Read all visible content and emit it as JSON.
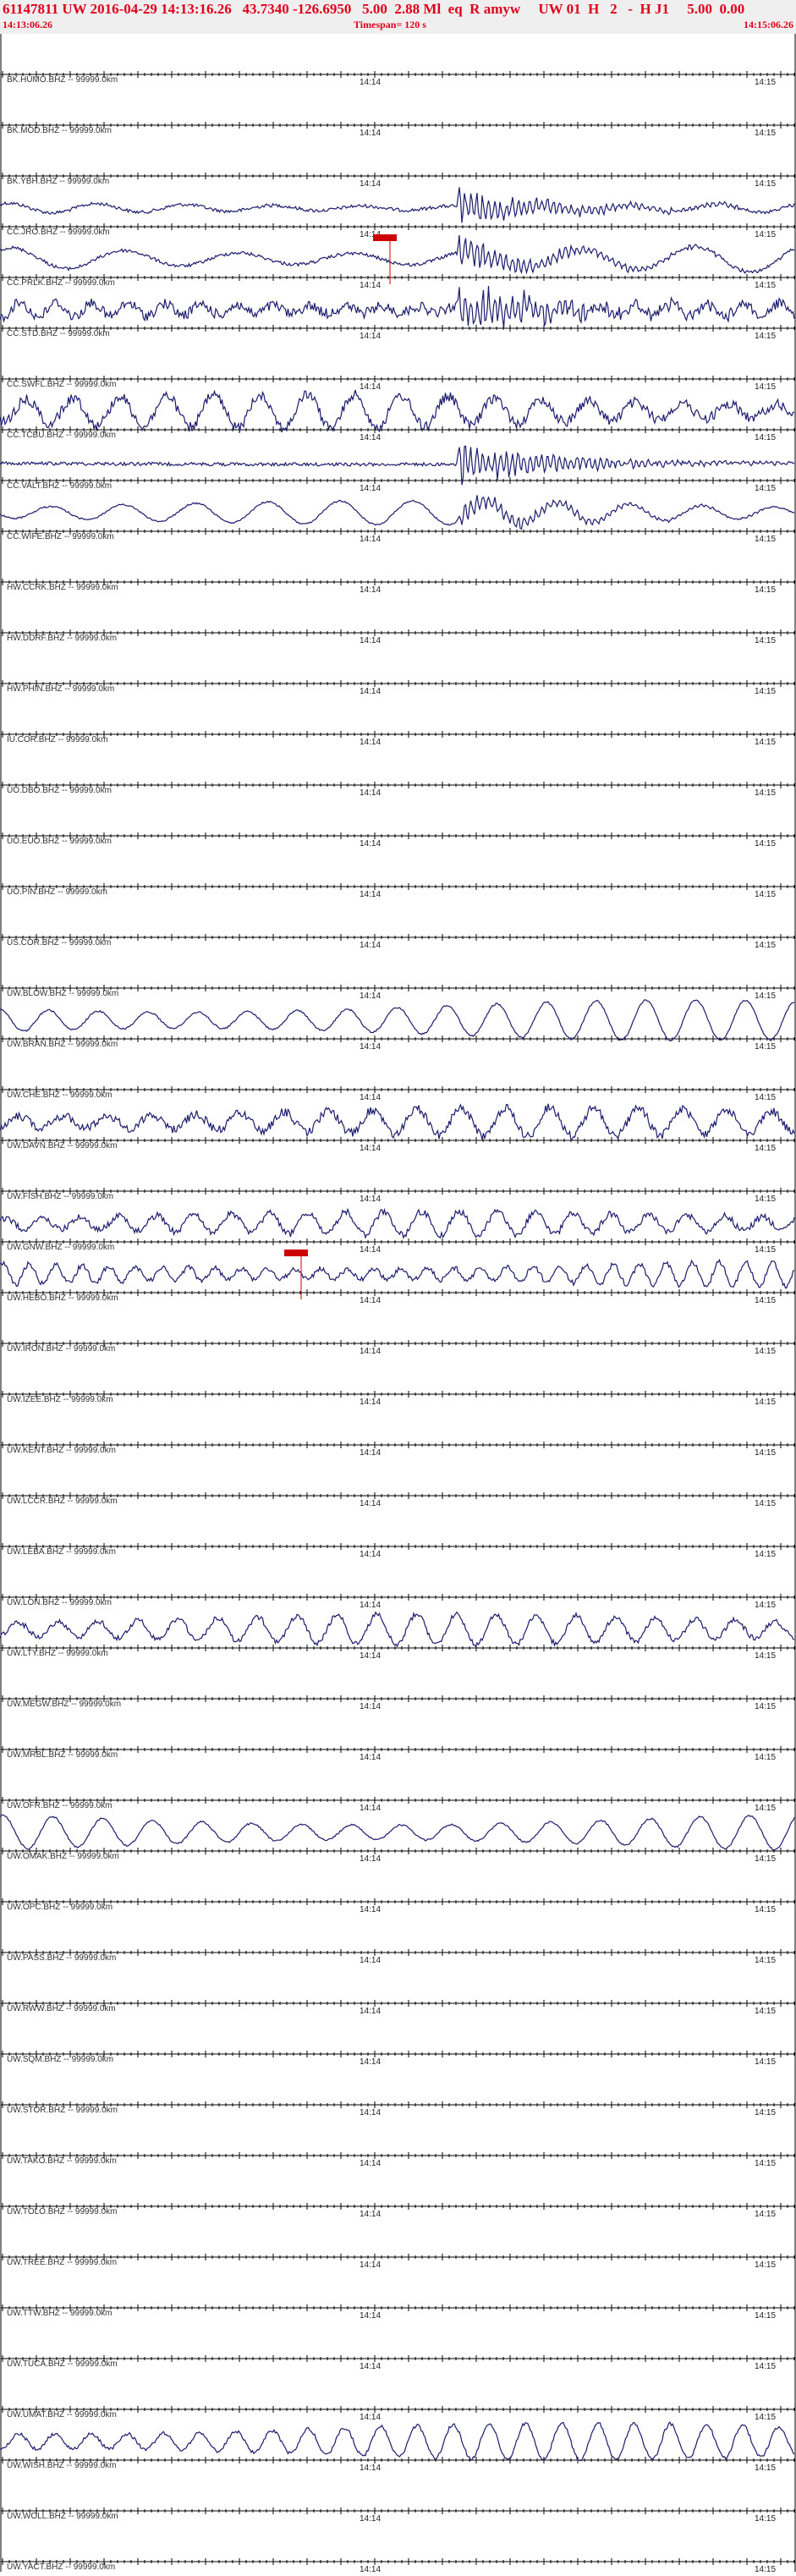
{
  "header": {
    "title": "61147811 UW 2016-04-29 14:13:16.26   43.7340 -126.6950   5.00  2.88 Ml  eq  R amyw     UW 01  H   2   -  H J1     5.00  0.00",
    "start_time": "14:13:06.26",
    "timespan": "Timespan= 120 s",
    "end_time": "14:15:06.26"
  },
  "tick_labels": {
    "mid": "14:14",
    "right": "14:15"
  },
  "colors": {
    "header_text": "#e0001b",
    "header_bg": "#efefef",
    "trace": "#1c1c6e",
    "pick": "#cc0000",
    "axis": "#000000"
  },
  "channels": [
    {
      "label": "BK.HUMO.BHZ -- 99999.0km",
      "amp": 0,
      "freq": 0,
      "noise": 0
    },
    {
      "label": "BK.MOD.BHZ -- 99999.0km",
      "amp": 0,
      "freq": 0,
      "noise": 0
    },
    {
      "label": "BK.YBH.BHZ -- 99999.0km",
      "amp": 0,
      "freq": 0,
      "noise": 0
    },
    {
      "label": "CC.JRO.BHZ -- 99999.0km",
      "amp": 6,
      "freq": 9,
      "noise": 2,
      "event_amp": 16
    },
    {
      "label": "CC.PRLK.BHZ -- 99999.0km",
      "amp": 16,
      "freq": 7,
      "noise": 2,
      "event_amp": 14,
      "pick": true
    },
    {
      "label": "CC.STD.BHZ -- 99999.0km",
      "amp": 9,
      "freq": 22,
      "noise": 6,
      "event_amp": 22
    },
    {
      "label": "CC.SWFL.BHZ -- 99999.0km",
      "amp": 0,
      "freq": 0,
      "noise": 0
    },
    {
      "label": "CC.TCBU.BHZ -- 99999.0km",
      "amp": 20,
      "freq": 17,
      "noise": 6
    },
    {
      "label": "CC.VALT.BHZ -- 99999.0km",
      "amp": 3,
      "freq": 0,
      "noise": 2,
      "event_amp": 20
    },
    {
      "label": "CC.WIFE.BHZ -- 99999.0km",
      "amp": 14,
      "freq": 11,
      "noise": 1,
      "event_amp": 10
    },
    {
      "label": "HW.CCRK.BHZ -- 99999.0km",
      "amp": 0,
      "freq": 0,
      "noise": 0
    },
    {
      "label": "HW.DDRF.BHZ -- 99999.0km",
      "amp": 0,
      "freq": 0,
      "noise": 0
    },
    {
      "label": "HW.PHIN.BHZ -- 99999.0km",
      "amp": 0,
      "freq": 0,
      "noise": 0
    },
    {
      "label": "IU.COR.BHZ -- 99999.0km",
      "amp": 0,
      "freq": 0,
      "noise": 0
    },
    {
      "label": "UO.DBO.BHZ -- 99999.0km",
      "amp": 0,
      "freq": 0,
      "noise": 0
    },
    {
      "label": "UO.EUO.BHZ -- 99999.0km",
      "amp": 0,
      "freq": 0,
      "noise": 0
    },
    {
      "label": "UO.PIN.BHZ -- 99999.0km",
      "amp": 0,
      "freq": 0,
      "noise": 0
    },
    {
      "label": "US.COR.BHZ -- 99999.0km",
      "amp": 0,
      "freq": 0,
      "noise": 0
    },
    {
      "label": "UW.BLOW.BHZ -- 99999.0km",
      "amp": 0,
      "freq": 0,
      "noise": 0
    },
    {
      "label": "UW.BRAN.BHZ -- 99999.0km",
      "amp": 24,
      "freq": 16,
      "noise": 1
    },
    {
      "label": "UW.CHE.BHZ -- 99999.0km",
      "amp": 0,
      "freq": 0,
      "noise": 0
    },
    {
      "label": "UW.DAVN.BHZ -- 99999.0km",
      "amp": 17,
      "freq": 18,
      "noise": 5
    },
    {
      "label": "UW.FISH.BHZ -- 99999.0km",
      "amp": 0,
      "freq": 0,
      "noise": 0
    },
    {
      "label": "UW.GNW.BHZ -- 99999.0km",
      "amp": 14,
      "freq": 21,
      "noise": 4
    },
    {
      "label": "UW.HEBO.BHZ -- 99999.0km",
      "amp": 15,
      "freq": 30,
      "noise": 3,
      "pick": true
    },
    {
      "label": "UW.IRON.BHZ -- 99999.0km",
      "amp": 0,
      "freq": 0,
      "noise": 0
    },
    {
      "label": "UW.IZEE.BHZ -- 99999.0km",
      "amp": 0,
      "freq": 0,
      "noise": 0
    },
    {
      "label": "UW.KENT.BHZ -- 99999.0km",
      "amp": 0,
      "freq": 0,
      "noise": 0
    },
    {
      "label": "UW.LCCR.BHZ -- 99999.0km",
      "amp": 0,
      "freq": 0,
      "noise": 0
    },
    {
      "label": "UW.LEBA.BHZ -- 99999.0km",
      "amp": 0,
      "freq": 0,
      "noise": 0
    },
    {
      "label": "UW.LON.BHZ -- 99999.0km",
      "amp": 0,
      "freq": 0,
      "noise": 0
    },
    {
      "label": "UW.LTY.BHZ -- 99999.0km",
      "amp": 18,
      "freq": 20,
      "noise": 3
    },
    {
      "label": "UW.MEGW.BHZ -- 99999.0km",
      "amp": 0,
      "freq": 0,
      "noise": 0
    },
    {
      "label": "UW.MRBL.BHZ -- 99999.0km",
      "amp": 0,
      "freq": 0,
      "noise": 0
    },
    {
      "label": "UW.OFR.BHZ -- 99999.0km",
      "amp": 0,
      "freq": 0,
      "noise": 0
    },
    {
      "label": "UW.OMAK.BHZ -- 99999.0km",
      "amp": 22,
      "freq": 16,
      "noise": 1
    },
    {
      "label": "UW.OPC.BHZ -- 99999.0km",
      "amp": 0,
      "freq": 0,
      "noise": 0
    },
    {
      "label": "UW.PASS.BHZ -- 99999.0km",
      "amp": 0,
      "freq": 0,
      "noise": 0
    },
    {
      "label": "UW.RWW.BHZ -- 99999.0km",
      "amp": 0,
      "freq": 0,
      "noise": 0
    },
    {
      "label": "UW.SQM.BHZ -- 99999.0km",
      "amp": 0,
      "freq": 0,
      "noise": 0
    },
    {
      "label": "UW.STOR.BHZ -- 99999.0km",
      "amp": 0,
      "freq": 0,
      "noise": 0
    },
    {
      "label": "UW.TAKO.BHZ -- 99999.0km",
      "amp": 0,
      "freq": 0,
      "noise": 0
    },
    {
      "label": "UW.TOLO.BHZ -- 99999.0km",
      "amp": 0,
      "freq": 0,
      "noise": 0
    },
    {
      "label": "UW.TREE.BHZ -- 99999.0km",
      "amp": 0,
      "freq": 0,
      "noise": 0
    },
    {
      "label": "UW.TTW.BHZ -- 99999.0km",
      "amp": 0,
      "freq": 0,
      "noise": 0
    },
    {
      "label": "UW.TUCA.BHZ -- 99999.0km",
      "amp": 0,
      "freq": 0,
      "noise": 0
    },
    {
      "label": "UW.UMAT.BHZ -- 99999.0km",
      "amp": 0,
      "freq": 0,
      "noise": 0
    },
    {
      "label": "UW.WISH.BHZ -- 99999.0km",
      "amp": 22,
      "freq": 22,
      "noise": 2
    },
    {
      "label": "UW.WOLL.BHZ -- 99999.0km",
      "amp": 0,
      "freq": 0,
      "noise": 0
    },
    {
      "label": "UW.YACT.BHZ -- 99999.0km",
      "amp": 0,
      "freq": 0,
      "noise": 0
    }
  ]
}
